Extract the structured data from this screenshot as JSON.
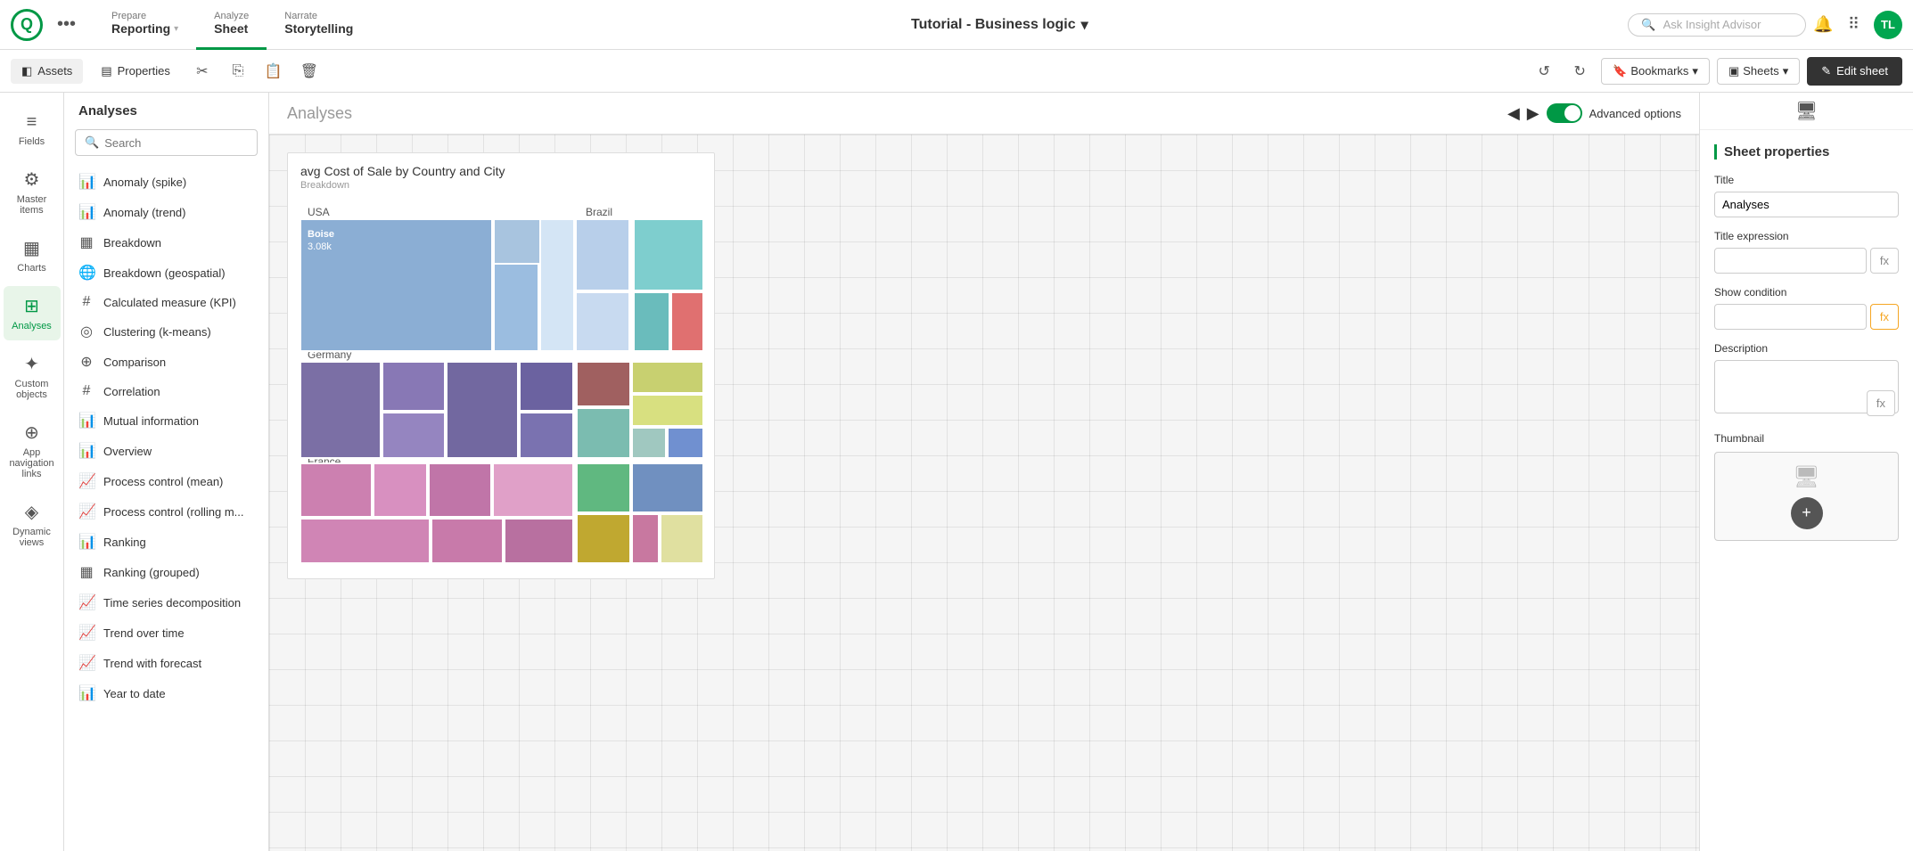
{
  "topNav": {
    "logo_text": "Qlik",
    "dots_label": "•••",
    "prepare_label": "Prepare",
    "prepare_value": "Reporting",
    "analyze_label": "Analyze",
    "analyze_value": "Sheet",
    "narrate_label": "Narrate",
    "narrate_value": "Storytelling",
    "app_title": "Tutorial - Business logic",
    "dropdown_arrow": "▾",
    "search_placeholder": "Ask Insight Advisor",
    "avatar_initials": "TL"
  },
  "secondToolbar": {
    "assets_label": "Assets",
    "properties_label": "Properties",
    "undo_label": "↺",
    "redo_label": "↻",
    "bookmarks_label": "Bookmarks",
    "sheets_label": "Sheets",
    "edit_sheet_label": "Edit sheet",
    "pencil_icon": "✎"
  },
  "sidebarIcons": [
    {
      "id": "fields",
      "icon": "≡",
      "label": "Fields",
      "active": false
    },
    {
      "id": "master-items",
      "icon": "⚙",
      "label": "Master items",
      "active": false
    },
    {
      "id": "charts",
      "icon": "▦",
      "label": "Charts",
      "active": false
    },
    {
      "id": "analyses",
      "icon": "⊞",
      "label": "Analyses",
      "active": true
    },
    {
      "id": "custom-objects",
      "icon": "✦",
      "label": "Custom objects",
      "active": false
    },
    {
      "id": "app-nav",
      "icon": "⊕",
      "label": "App navigation links",
      "active": false
    },
    {
      "id": "dynamic-views",
      "icon": "◈",
      "label": "Dynamic views",
      "active": false
    }
  ],
  "analysesPanel": {
    "title": "Analyses",
    "search_placeholder": "Search",
    "items": [
      {
        "id": "anomaly-spike",
        "icon": "📊",
        "label": "Anomaly (spike)"
      },
      {
        "id": "anomaly-trend",
        "icon": "📊",
        "label": "Anomaly (trend)"
      },
      {
        "id": "breakdown",
        "icon": "▦",
        "label": "Breakdown"
      },
      {
        "id": "breakdown-geo",
        "icon": "🌐",
        "label": "Breakdown (geospatial)"
      },
      {
        "id": "calculated-measure",
        "icon": "#",
        "label": "Calculated measure (KPI)"
      },
      {
        "id": "clustering",
        "icon": "◎",
        "label": "Clustering (k-means)"
      },
      {
        "id": "comparison",
        "icon": "⊕",
        "label": "Comparison"
      },
      {
        "id": "correlation",
        "icon": "#",
        "label": "Correlation"
      },
      {
        "id": "mutual-info",
        "icon": "📊",
        "label": "Mutual information"
      },
      {
        "id": "overview",
        "icon": "📊",
        "label": "Overview"
      },
      {
        "id": "process-mean",
        "icon": "📈",
        "label": "Process control (mean)"
      },
      {
        "id": "process-rolling",
        "icon": "📈",
        "label": "Process control (rolling m..."
      },
      {
        "id": "ranking",
        "icon": "📊",
        "label": "Ranking"
      },
      {
        "id": "ranking-grouped",
        "icon": "▦",
        "label": "Ranking (grouped)"
      },
      {
        "id": "time-series",
        "icon": "📈",
        "label": "Time series decomposition"
      },
      {
        "id": "trend-time",
        "icon": "📈",
        "label": "Trend over time"
      },
      {
        "id": "trend-forecast",
        "icon": "📈",
        "label": "Trend with forecast"
      },
      {
        "id": "year-to-date",
        "icon": "📊",
        "label": "Year to date"
      }
    ]
  },
  "contentHeader": {
    "title": "Analyses",
    "advanced_options_label": "Advanced options",
    "prev_arrow": "◀",
    "next_arrow": "▶"
  },
  "treemap": {
    "title": "avg Cost of Sale by Country and City",
    "subtitle": "Breakdown",
    "usa_label": "USA",
    "brazil_label": "Brazil",
    "germany_label": "Germany",
    "france_label": "France",
    "boise_label": "Boise",
    "boise_value": "3.08k"
  },
  "sheetProperties": {
    "section_title": "Sheet properties",
    "title_label": "Title",
    "title_value": "Analyses",
    "title_expression_label": "Title expression",
    "show_condition_label": "Show condition",
    "description_label": "Description",
    "thumbnail_label": "Thumbnail",
    "fx_label": "fx"
  }
}
